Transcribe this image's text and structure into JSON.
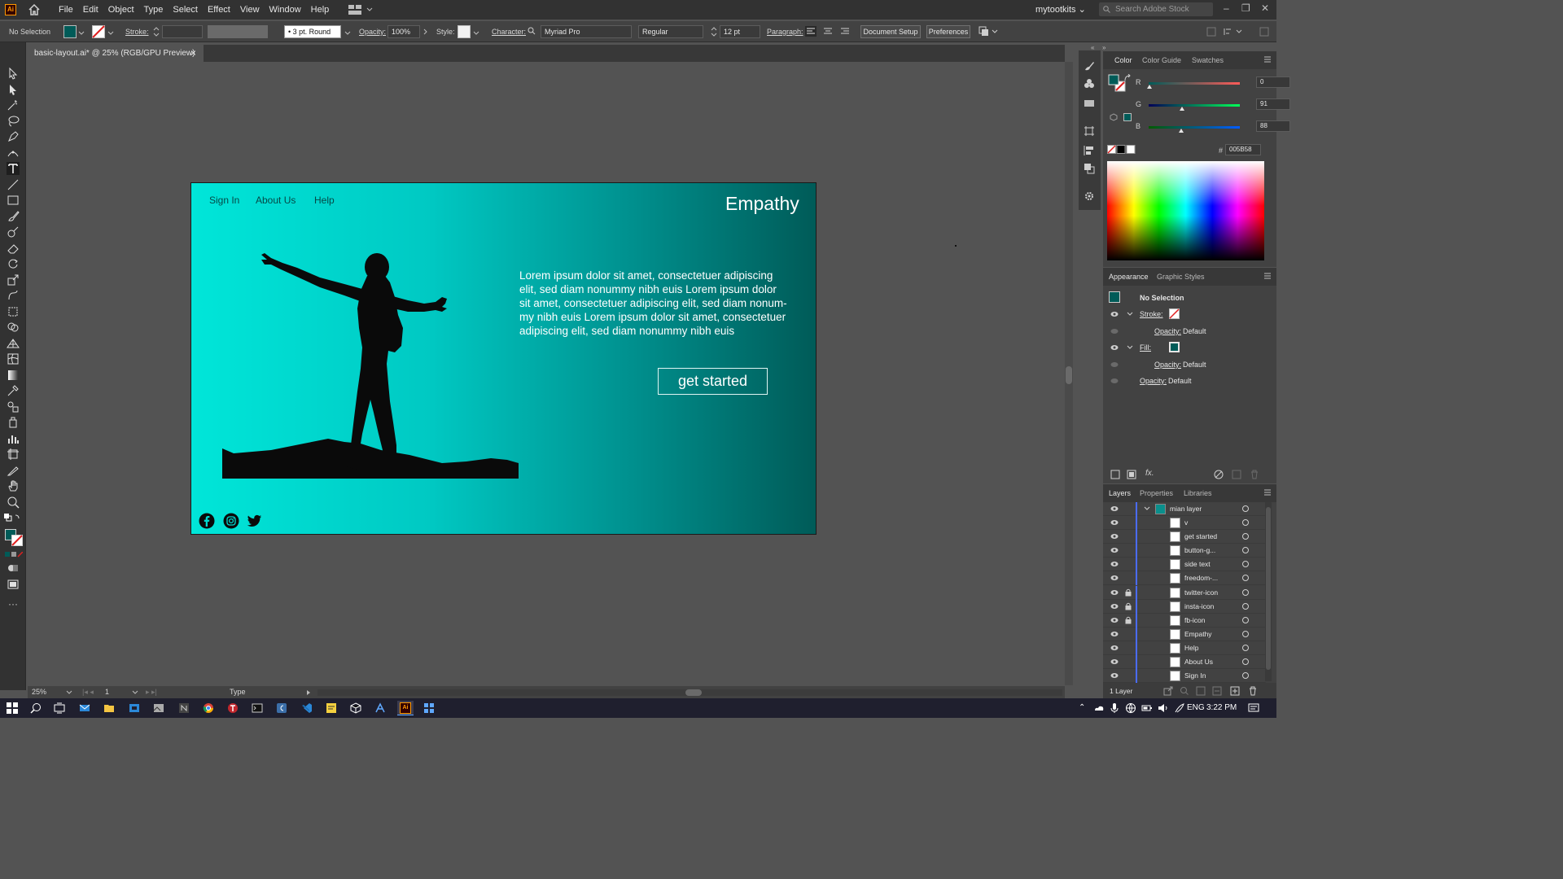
{
  "app": {
    "logo": "Ai",
    "menus": [
      "File",
      "Edit",
      "Object",
      "Type",
      "Select",
      "Effect",
      "View",
      "Window",
      "Help"
    ],
    "user": "mytootkits",
    "stock_search_placeholder": "Search Adobe Stock"
  },
  "control_bar": {
    "selection": "No Selection",
    "stroke_label": "Stroke:",
    "brush": "3 pt. Round",
    "opacity_label": "Opacity:",
    "opacity_value": "100%",
    "style_label": "Style:",
    "character_label": "Character:",
    "font_family": "Myriad Pro",
    "font_style": "Regular",
    "font_size": "12 pt",
    "paragraph_label": "Paragraph:",
    "document_setup": "Document Setup",
    "preferences": "Preferences"
  },
  "document_tab": {
    "title": "basic-layout.ai* @ 25% (RGB/GPU Preview)",
    "close": "×"
  },
  "artboard": {
    "nav": [
      "Sign In",
      "About Us",
      "Help"
    ],
    "brand": "Empathy",
    "body_lines": [
      "Lorem ipsum dolor sit amet, consectetuer adipiscing",
      "elit, sed diam nonummy nibh euis Lorem ipsum dolor",
      "sit amet, consectetuer adipiscing elit, sed diam nonum-",
      "my nibh euis Lorem ipsum dolor sit amet, consectetuer",
      "adipiscing elit, sed diam nonummy nibh euis"
    ],
    "cta": "get started",
    "social_icons": [
      "facebook-icon",
      "instagram-icon",
      "twitter-icon"
    ],
    "gradient_colors": [
      "#00e6d9",
      "#005b58"
    ],
    "text_color": "#064846"
  },
  "color_panel": {
    "tabs": [
      "Color",
      "Color Guide",
      "Swatches"
    ],
    "active_tab": "Color",
    "r_label": "R",
    "g_label": "G",
    "b_label": "B",
    "r": "0",
    "g": "91",
    "b": "88",
    "hex_prefix": "#",
    "hex": "005B58",
    "fill_color": "#005b58"
  },
  "appearance_panel": {
    "tabs": [
      "Appearance",
      "Graphic Styles"
    ],
    "active_tab": "Appearance",
    "title": "No Selection",
    "stroke_label": "Stroke:",
    "fill_label": "Fill:",
    "opacity_label": "Opacity:",
    "opacity_default": "Default"
  },
  "layers_panel": {
    "tabs": [
      "Layers",
      "Properties",
      "Libraries"
    ],
    "active_tab": "Layers",
    "main_layer": "mian layer",
    "items": [
      {
        "name": "v",
        "locked": false
      },
      {
        "name": "get started",
        "locked": false
      },
      {
        "name": "button-g...",
        "locked": false
      },
      {
        "name": "side text",
        "locked": false
      },
      {
        "name": "freedom-...",
        "locked": false
      },
      {
        "name": "twitter-icon",
        "locked": true
      },
      {
        "name": "insta-icon",
        "locked": true
      },
      {
        "name": "fb-icon",
        "locked": true
      },
      {
        "name": "Empathy",
        "locked": false
      },
      {
        "name": "Help",
        "locked": false
      },
      {
        "name": "About Us",
        "locked": false
      },
      {
        "name": "Sign In",
        "locked": false
      }
    ],
    "footer": "1 Layer"
  },
  "status_bar": {
    "zoom": "25%",
    "artboard_number": "1",
    "tool": "Type"
  },
  "taskbar": {
    "language": "ENG",
    "time": "3:22 PM"
  }
}
